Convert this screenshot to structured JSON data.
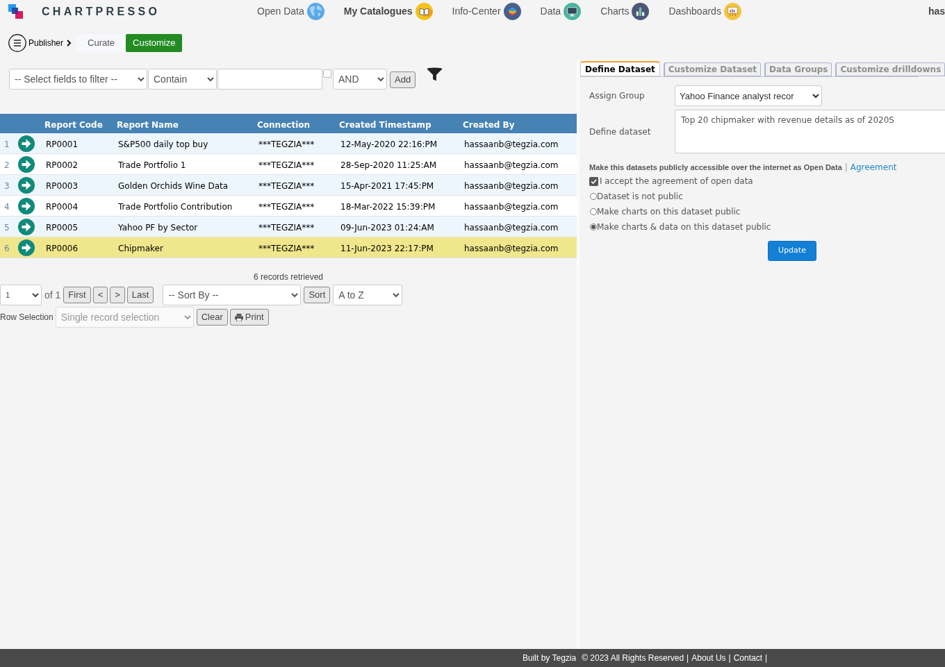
{
  "brand": {
    "name": "CHARTPRESSO"
  },
  "nav": [
    {
      "label": "Open Data",
      "kind": "globe",
      "selected": false
    },
    {
      "label": "My Catalogues",
      "kind": "book",
      "selected": true
    },
    {
      "label": "Info-Center",
      "kind": "layers",
      "selected": false
    },
    {
      "label": "Data",
      "kind": "monitor",
      "selected": false
    },
    {
      "label": "Charts",
      "kind": "bars",
      "selected": false
    },
    {
      "label": "Dashboards",
      "kind": "board",
      "selected": false
    }
  ],
  "user": {
    "name": "has"
  },
  "breadcrumb": {
    "label": "Publisher"
  },
  "mode_tabs": [
    {
      "label": "Curate",
      "selected": false
    },
    {
      "label": "Customize",
      "selected": true
    }
  ],
  "filter": {
    "field_select": "-- Select fields to filter --",
    "operator_select": "Contain",
    "option_checkbox": {
      "checked": false
    },
    "logic_select": "AND",
    "add_button": "Add"
  },
  "table": {
    "columns": [
      "Report Code",
      "Report Name",
      "Connection",
      "Created Timestamp",
      "Created By"
    ],
    "rows": [
      {
        "number": "1",
        "selected": false,
        "cells": [
          "RP0001",
          "S&P500 daily top buy",
          "***TEGZIA***",
          "12-May-2020 22:16:PM",
          "hassaanb@tegzia.com"
        ]
      },
      {
        "number": "2",
        "selected": false,
        "cells": [
          "RP0002",
          "Trade Portfolio 1",
          "***TEGZIA***",
          "28-Sep-2020 11:25:AM",
          "hassaanb@tegzia.com"
        ]
      },
      {
        "number": "3",
        "selected": false,
        "cells": [
          "RP0003",
          "Golden Orchids Wine Data",
          "***TEGZIA***",
          "15-Apr-2021 17:45:PM",
          "hassaanb@tegzia.com"
        ]
      },
      {
        "number": "4",
        "selected": false,
        "cells": [
          "RP0004",
          "Trade Portfolio Contribution",
          "***TEGZIA***",
          "18-Mar-2022 15:39:PM",
          "hassaanb@tegzia.com"
        ]
      },
      {
        "number": "5",
        "selected": false,
        "cells": [
          "RP0005",
          "Yahoo PF by Sector",
          "***TEGZIA***",
          "09-Jun-2023 01:24:AM",
          "hassaanb@tegzia.com"
        ]
      },
      {
        "number": "6",
        "selected": true,
        "cells": [
          "RP0006",
          "Chipmaker",
          "***TEGZIA***",
          "11-Jun-2023 22:17:PM",
          "hassaanb@tegzia.com"
        ]
      }
    ]
  },
  "pager": {
    "records": "6 records retrieved",
    "page_select": "1",
    "page_total": "of 1",
    "buttons": [
      "First",
      "<",
      ">",
      "Last"
    ],
    "sort_select": "-- Sort By --",
    "sort_button": "Sort",
    "order_select": "A to Z"
  },
  "row_selection": {
    "label": "Row Selection",
    "select": "Single record selection",
    "buttons": [
      {
        "label": "Clear",
        "kind": "plain"
      },
      {
        "label": "Print",
        "kind": "print"
      }
    ]
  },
  "dataset_tabs": [
    {
      "label": "Define Dataset",
      "selected": true
    },
    {
      "label": "Customize Dataset",
      "selected": false
    },
    {
      "label": "Data Groups",
      "selected": false
    },
    {
      "label": "Customize drilldowns",
      "selected": false
    }
  ],
  "form": {
    "assign_group_label": "Assign Group",
    "assign_group_value": "Yahoo Finance analyst recor",
    "define_label": "Define dataset",
    "define_value": "Top 20 chipmaker with revenue details as of 2020S",
    "public_heading": "Make this datasets publicly accessible over the internet as Open Data",
    "separator": "|",
    "agreement_link": "Agreement",
    "accept": {
      "label": "I accept the agreement of open data",
      "checked": true
    },
    "visibility": [
      {
        "label": "Dataset is not public",
        "selected": false
      },
      {
        "label": "Make charts on this dataset public",
        "selected": false
      },
      {
        "label": "Make charts & data on this dataset public",
        "selected": true
      }
    ],
    "update_button": "Update"
  },
  "footer": [
    {
      "text": "Built by Tegzia",
      "kind": "text"
    },
    {
      "text": "© 2023 All Rights Reserved",
      "kind": "text"
    },
    {
      "text": "|",
      "kind": "separator"
    },
    {
      "text": "About Us",
      "kind": "link"
    },
    {
      "text": "|",
      "kind": "separator"
    },
    {
      "text": "Contact",
      "kind": "link"
    },
    {
      "text": "|",
      "kind": "separator"
    }
  ]
}
